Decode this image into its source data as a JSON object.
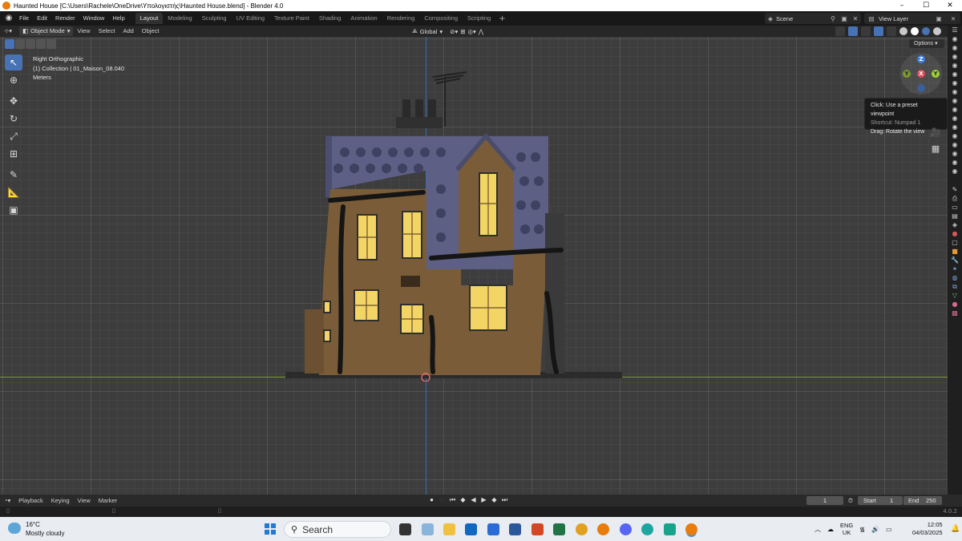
{
  "window": {
    "title": "Haunted House [C:\\Users\\Rachele\\OneDrive\\Υπολογιστής\\Haunted House.blend] - Blender 4.0",
    "minimize": "–",
    "maximize": "☐",
    "close": "✕"
  },
  "topbar": {
    "menus": [
      "File",
      "Edit",
      "Render",
      "Window",
      "Help"
    ],
    "workspaces": [
      "Layout",
      "Modeling",
      "Sculpting",
      "UV Editing",
      "Texture Paint",
      "Shading",
      "Animation",
      "Rendering",
      "Compositing",
      "Scripting"
    ],
    "active_workspace": "Layout",
    "add_workspace": "+",
    "scene_label": "Scene",
    "view_layer_label": "View Layer"
  },
  "viewport_header": {
    "mode": "Object Mode",
    "menus": [
      "View",
      "Select",
      "Add",
      "Object"
    ],
    "transform_orientation": "Global"
  },
  "viewport": {
    "view_name": "Right Orthographic",
    "collection": "(1) Collection | 01_Maison_08.040",
    "units": "Meters",
    "options_label": "Options"
  },
  "gizmo": {
    "z": "Z",
    "y": "Y",
    "x": "X",
    "neg_y": "Y"
  },
  "tooltip": {
    "line1": "Click: Use a preset viewpoint",
    "line2": "Shortcut: Numpad 1",
    "line3": "Drag: Rotate the view"
  },
  "timeline": {
    "menus": [
      "Playback",
      "Keying",
      "View",
      "Marker"
    ],
    "current_frame": "1",
    "start_label": "Start",
    "start_value": "1",
    "end_label": "End",
    "end_value": "250"
  },
  "statusbar": {
    "version": "4.0.2"
  },
  "taskbar": {
    "temperature": "16°C",
    "weather": "Mostly cloudy",
    "search_placeholder": "Search",
    "lang1": "ENG",
    "lang2": "UK",
    "time": "12:05",
    "date": "04/03/2025"
  },
  "colors": {
    "accent": "#4772b3",
    "z_axis": "#3f6ea8",
    "y_axis": "#7a9a2f",
    "viewport_bg": "#3d3d3d"
  }
}
